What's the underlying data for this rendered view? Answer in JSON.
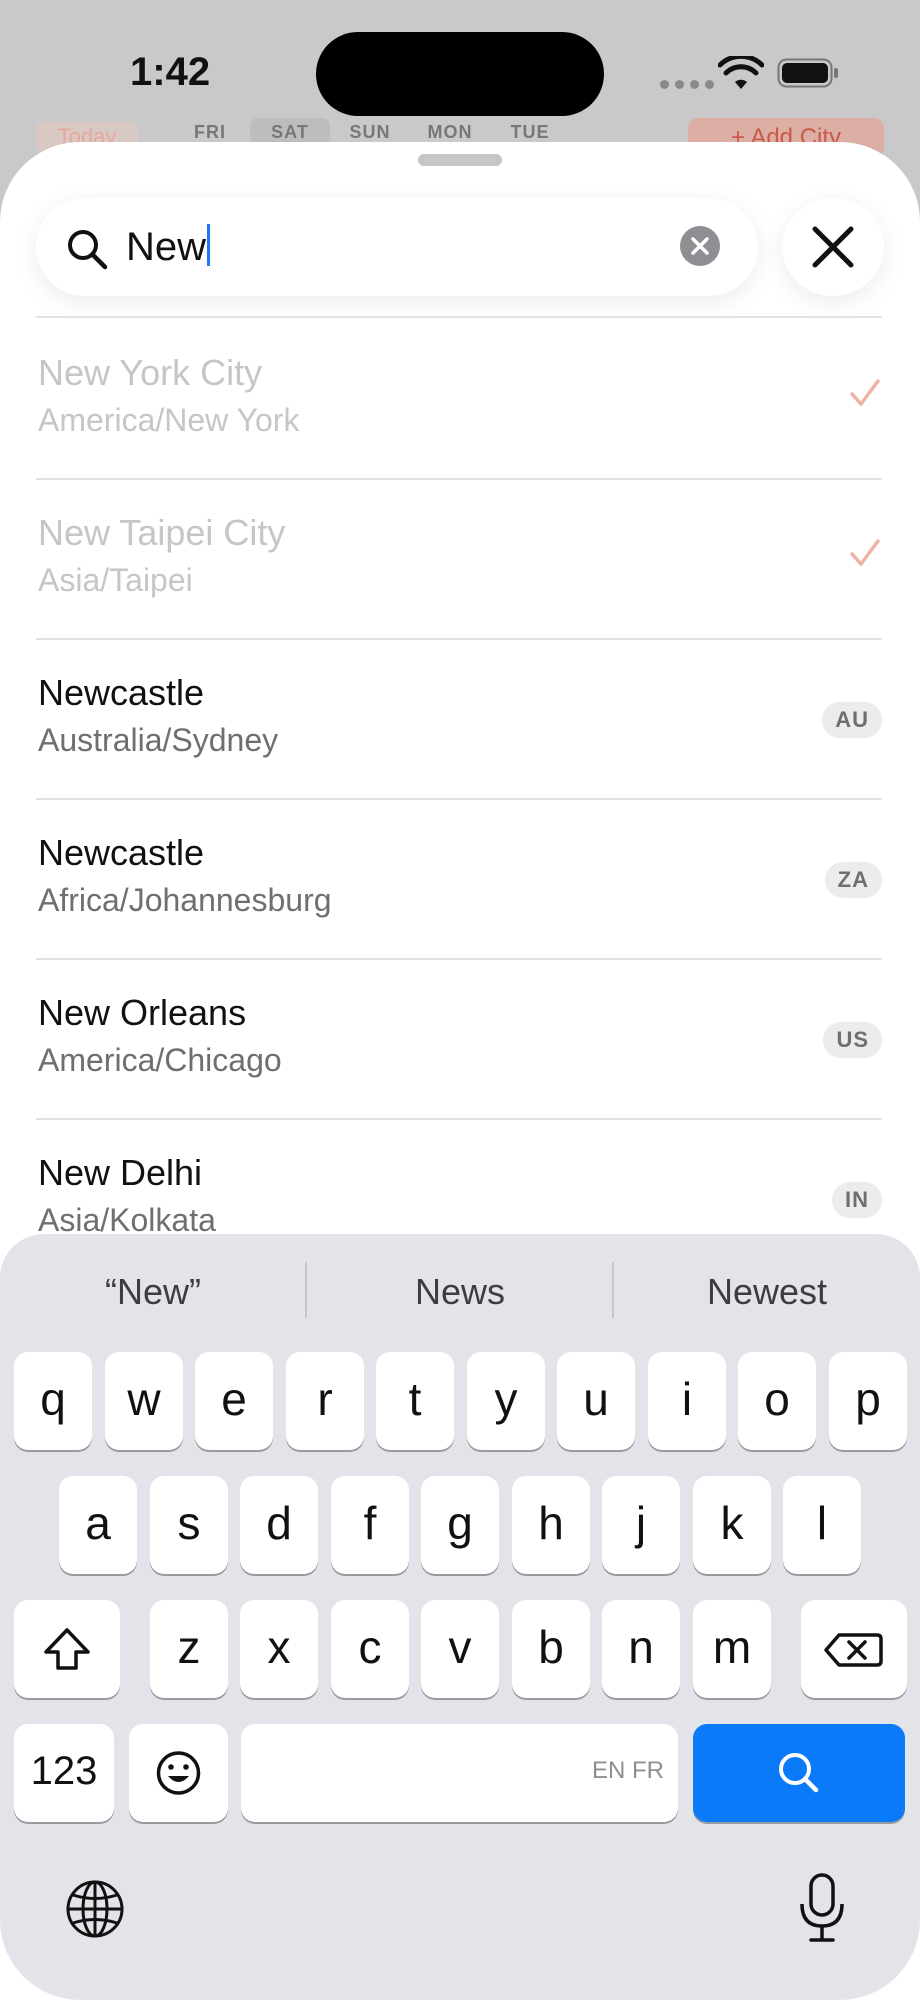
{
  "status_bar": {
    "time": "1:42"
  },
  "background": {
    "today_label": "Today",
    "days": [
      "FRI",
      "SAT",
      "SUN",
      "MON",
      "TUE"
    ],
    "selected_day": "SAT",
    "add_city_label": "+ Add City"
  },
  "search": {
    "query": "New"
  },
  "results": [
    {
      "city": "New York City",
      "timezone": "America/New York",
      "added": true,
      "country": ""
    },
    {
      "city": "New Taipei City",
      "timezone": "Asia/Taipei",
      "added": true,
      "country": ""
    },
    {
      "city": "Newcastle",
      "timezone": "Australia/Sydney",
      "added": false,
      "country": "AU"
    },
    {
      "city": "Newcastle",
      "timezone": "Africa/Johannesburg",
      "added": false,
      "country": "ZA"
    },
    {
      "city": "New Orleans",
      "timezone": "America/Chicago",
      "added": false,
      "country": "US"
    },
    {
      "city": "New Delhi",
      "timezone": "Asia/Kolkata",
      "added": false,
      "country": "IN"
    }
  ],
  "keyboard": {
    "suggestions": [
      "“New”",
      "News",
      "Newest"
    ],
    "row1": [
      "q",
      "w",
      "e",
      "r",
      "t",
      "y",
      "u",
      "i",
      "o",
      "p"
    ],
    "row2": [
      "a",
      "s",
      "d",
      "f",
      "g",
      "h",
      "j",
      "k",
      "l"
    ],
    "row3": [
      "z",
      "x",
      "c",
      "v",
      "b",
      "n",
      "m"
    ],
    "numbers_key": "123",
    "space_hint": "EN FR"
  },
  "colors": {
    "accent_check": "#f0b2a6",
    "keyboard_action": "#0a7af8",
    "caret": "#1f78f0"
  }
}
